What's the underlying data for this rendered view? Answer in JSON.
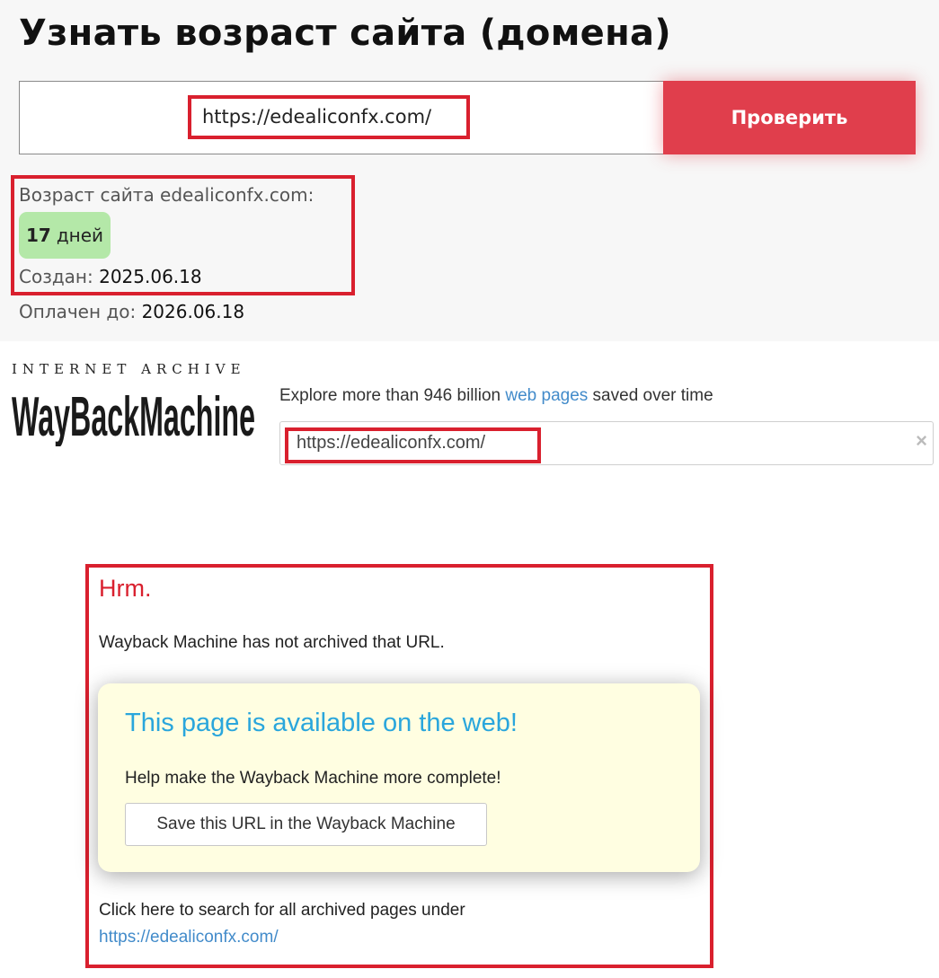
{
  "age_checker": {
    "title": "Узнать возраст сайта (домена)",
    "input_value": "https://edealiconfx.com/",
    "check_button_label": "Проверить",
    "age_label": "Возраст сайта edealiconfx.com:",
    "age_value": "17",
    "age_unit": "дней",
    "created_label": "Создан:",
    "created_value": "2025.06.18",
    "paid_label": "Оплачен до:",
    "paid_value": "2026.06.18",
    "accent_color": "#e03e4c",
    "badge_color": "#b4e8a8"
  },
  "wayback": {
    "logo_top_text": "INTERNET ARCHIVE",
    "logo_text": "WayBackMachine",
    "explore_prefix": "Explore more than 946 billion ",
    "explore_link": "web pages",
    "explore_suffix": " saved over time",
    "search_value": "https://edealiconfx.com/",
    "clear_symbol": "×",
    "hrm_title": "Hrm.",
    "not_archived": "Wayback Machine has not archived that URL.",
    "available_title": "This page is available on the web!",
    "help_text": "Help make the Wayback Machine more complete!",
    "save_button_label": "Save this URL in the Wayback Machine",
    "search_all_text": "Click here to search for all archived pages under",
    "search_all_link": "https://edealiconfx.com/",
    "link_color": "#428bca",
    "highlight_color": "#d9202e"
  }
}
